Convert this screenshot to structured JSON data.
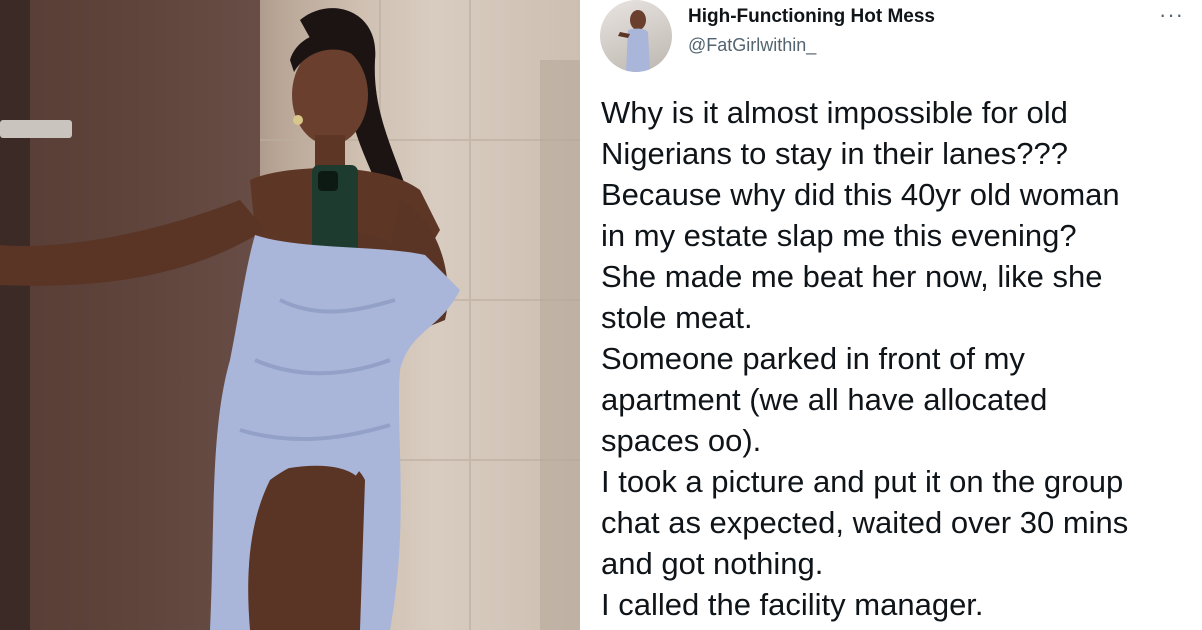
{
  "tweet": {
    "display_name": "High-Functioning Hot Mess",
    "handle": "@FatGirlwithin_",
    "more_icon": "more-horizontal-icon",
    "body": "Why is it almost impossible for old\nNigerians to stay in their lanes???\nBecause why did this 40yr old woman\nin my estate slap me this evening?\nShe made me beat her now, like she\nstole meat.\nSomeone parked in front of my\napartment (we all have allocated\nspaces oo).\nI took a picture and put it on the group\nchat as expected, waited over 30 mins\nand got nothing.\nI called the facility manager."
  },
  "colors": {
    "text": "#0f1419",
    "secondary": "#536471",
    "dress": "#a9b6d9"
  }
}
